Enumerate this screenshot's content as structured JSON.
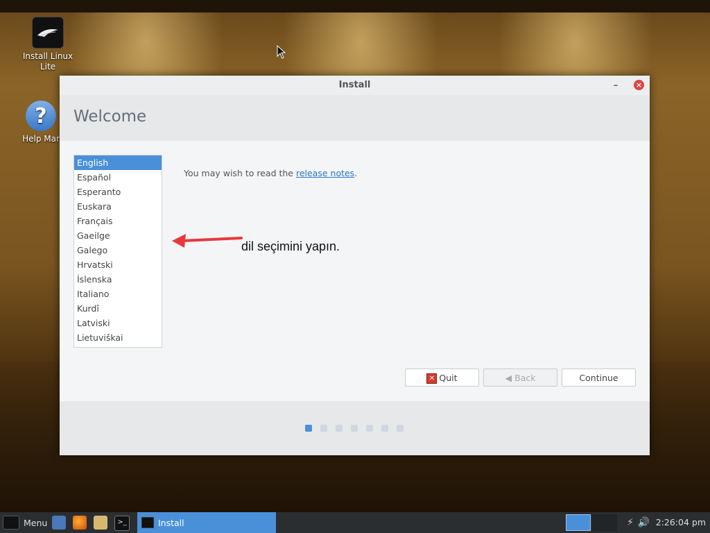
{
  "desktop": {
    "icons": [
      {
        "label": "Install Linux Lite"
      },
      {
        "label": "Help Mar"
      }
    ]
  },
  "window": {
    "title": "Install",
    "minimize_glyph": "–",
    "close_glyph": "×",
    "header_title": "Welcome",
    "languages": [
      "English",
      "Español",
      "Esperanto",
      "Euskara",
      "Français",
      "Gaeilge",
      "Galego",
      "Hrvatski",
      "Íslenska",
      "Italiano",
      "Kurdî",
      "Latviski",
      "Lietuviškai"
    ],
    "selected_language": "English",
    "notes_prefix": "You may wish to read the ",
    "notes_link": "release notes",
    "notes_suffix": ".",
    "buttons": {
      "quit": "Quit",
      "back": "Back",
      "continue": "Continue"
    },
    "progress": {
      "total_steps": 7,
      "current_step": 1
    }
  },
  "annotation": {
    "text": "dil seçimini yapın.",
    "arrow_color": "#e8383d"
  },
  "taskbar": {
    "menu_label": "Menu",
    "active_task": "Install",
    "clock": "2:26:04 pm",
    "accent": "#4a90d9"
  }
}
